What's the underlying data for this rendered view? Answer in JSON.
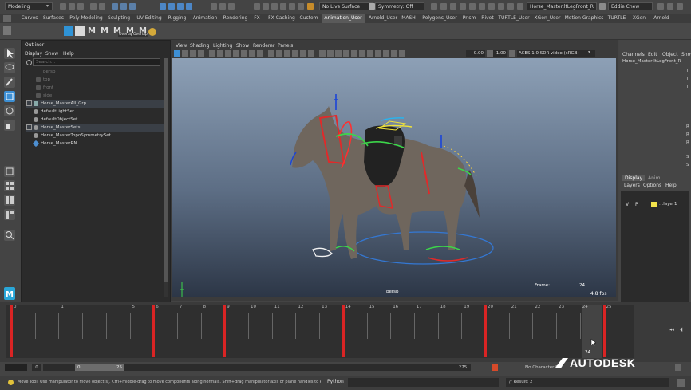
{
  "status_line": {
    "menu_set": "Modeling",
    "live_surface": "No Live Surface",
    "symmetry": "Symmetry: Off",
    "selection_field": "Horse_Master:ltLegFront_R",
    "user_name": "Eddie Chew"
  },
  "shelf_tabs": [
    "Curves",
    "Surfaces",
    "Poly Modeling",
    "Sculpting",
    "UV Editing",
    "Rigging",
    "Animation",
    "Rendering",
    "FX",
    "FX Caching",
    "Custom",
    "Animation_User",
    "Arnold_User",
    "MASH",
    "Polygons_User",
    "Prism",
    "Rivet",
    "TURTLE_User",
    "XGen_User",
    "Motion Graphics",
    "TURTLE",
    "XGen",
    "Arnold"
  ],
  "active_shelf_tab": "Animation_User",
  "shelf": {
    "labels": [
      "M",
      "M",
      "M",
      "M",
      "M",
      "Overlap",
      "Overlap"
    ]
  },
  "outliner": {
    "title": "Outliner",
    "menu": [
      "Display",
      "Show",
      "Help"
    ],
    "search_placeholder": "Search...",
    "items": [
      {
        "label": "persp",
        "dim": true
      },
      {
        "label": "top",
        "dim": true
      },
      {
        "label": "front",
        "dim": true
      },
      {
        "label": "side",
        "dim": true
      },
      {
        "label": "Horse_MasterAll_Grp",
        "dim": false
      },
      {
        "label": "defaultLightSet",
        "dim": false
      },
      {
        "label": "defaultObjectSet",
        "dim": false
      },
      {
        "label": "Horse_MasterSets",
        "dim": false
      },
      {
        "label": "Horse_MasterTopoSymmetrySet",
        "dim": false
      },
      {
        "label": "Horse_MasterRN",
        "dim": false
      }
    ]
  },
  "viewport": {
    "menu": [
      "View",
      "Shading",
      "Lighting",
      "Show",
      "Renderer",
      "Panels"
    ],
    "value_1": "0.00",
    "value_2": "1.00",
    "color_space": "ACES 1.0 SDR-video (sRGB)",
    "camera_label": "persp",
    "frame_label": "Frame:",
    "frame_value": "24",
    "fps": "4.8 fps"
  },
  "channel_box": {
    "menu": [
      "Channels",
      "Edit",
      "Object",
      "Show"
    ],
    "object_name": "Horse_Master:ltLegFront_R",
    "side_letters": [
      "T",
      "T",
      "T",
      "R",
      "R",
      "R",
      "S",
      "S"
    ],
    "layer_tabs": [
      "Display",
      "Anim"
    ],
    "layer_menu": [
      "Layers",
      "Options",
      "Help"
    ],
    "layer_row": {
      "v": "V",
      "p": "P",
      "name": "...layer1"
    }
  },
  "timeline": {
    "ticks": [
      "0",
      "1",
      "5",
      "6",
      "7",
      "8",
      "9",
      "10",
      "11",
      "12",
      "13",
      "14",
      "15",
      "16",
      "17",
      "18",
      "19",
      "20",
      "21",
      "22",
      "23",
      "24",
      "25"
    ],
    "current_frame": "24",
    "keyframes": [
      "0",
      "6",
      "9",
      "14",
      "20",
      "25"
    ]
  },
  "range_slider": {
    "start": "0",
    "range_start": "0",
    "range_end": "25",
    "end": "275",
    "char_set": "No Character Set"
  },
  "help_line": "Move Tool: Use manipulator to move object(s). Ctrl+middle-drag to move components along normals. Shift+drag manipulator axis or plane handles to extrude components or",
  "command_line": {
    "language": "Python",
    "result": "// Result: 2"
  },
  "watermark": "AUTODESK"
}
